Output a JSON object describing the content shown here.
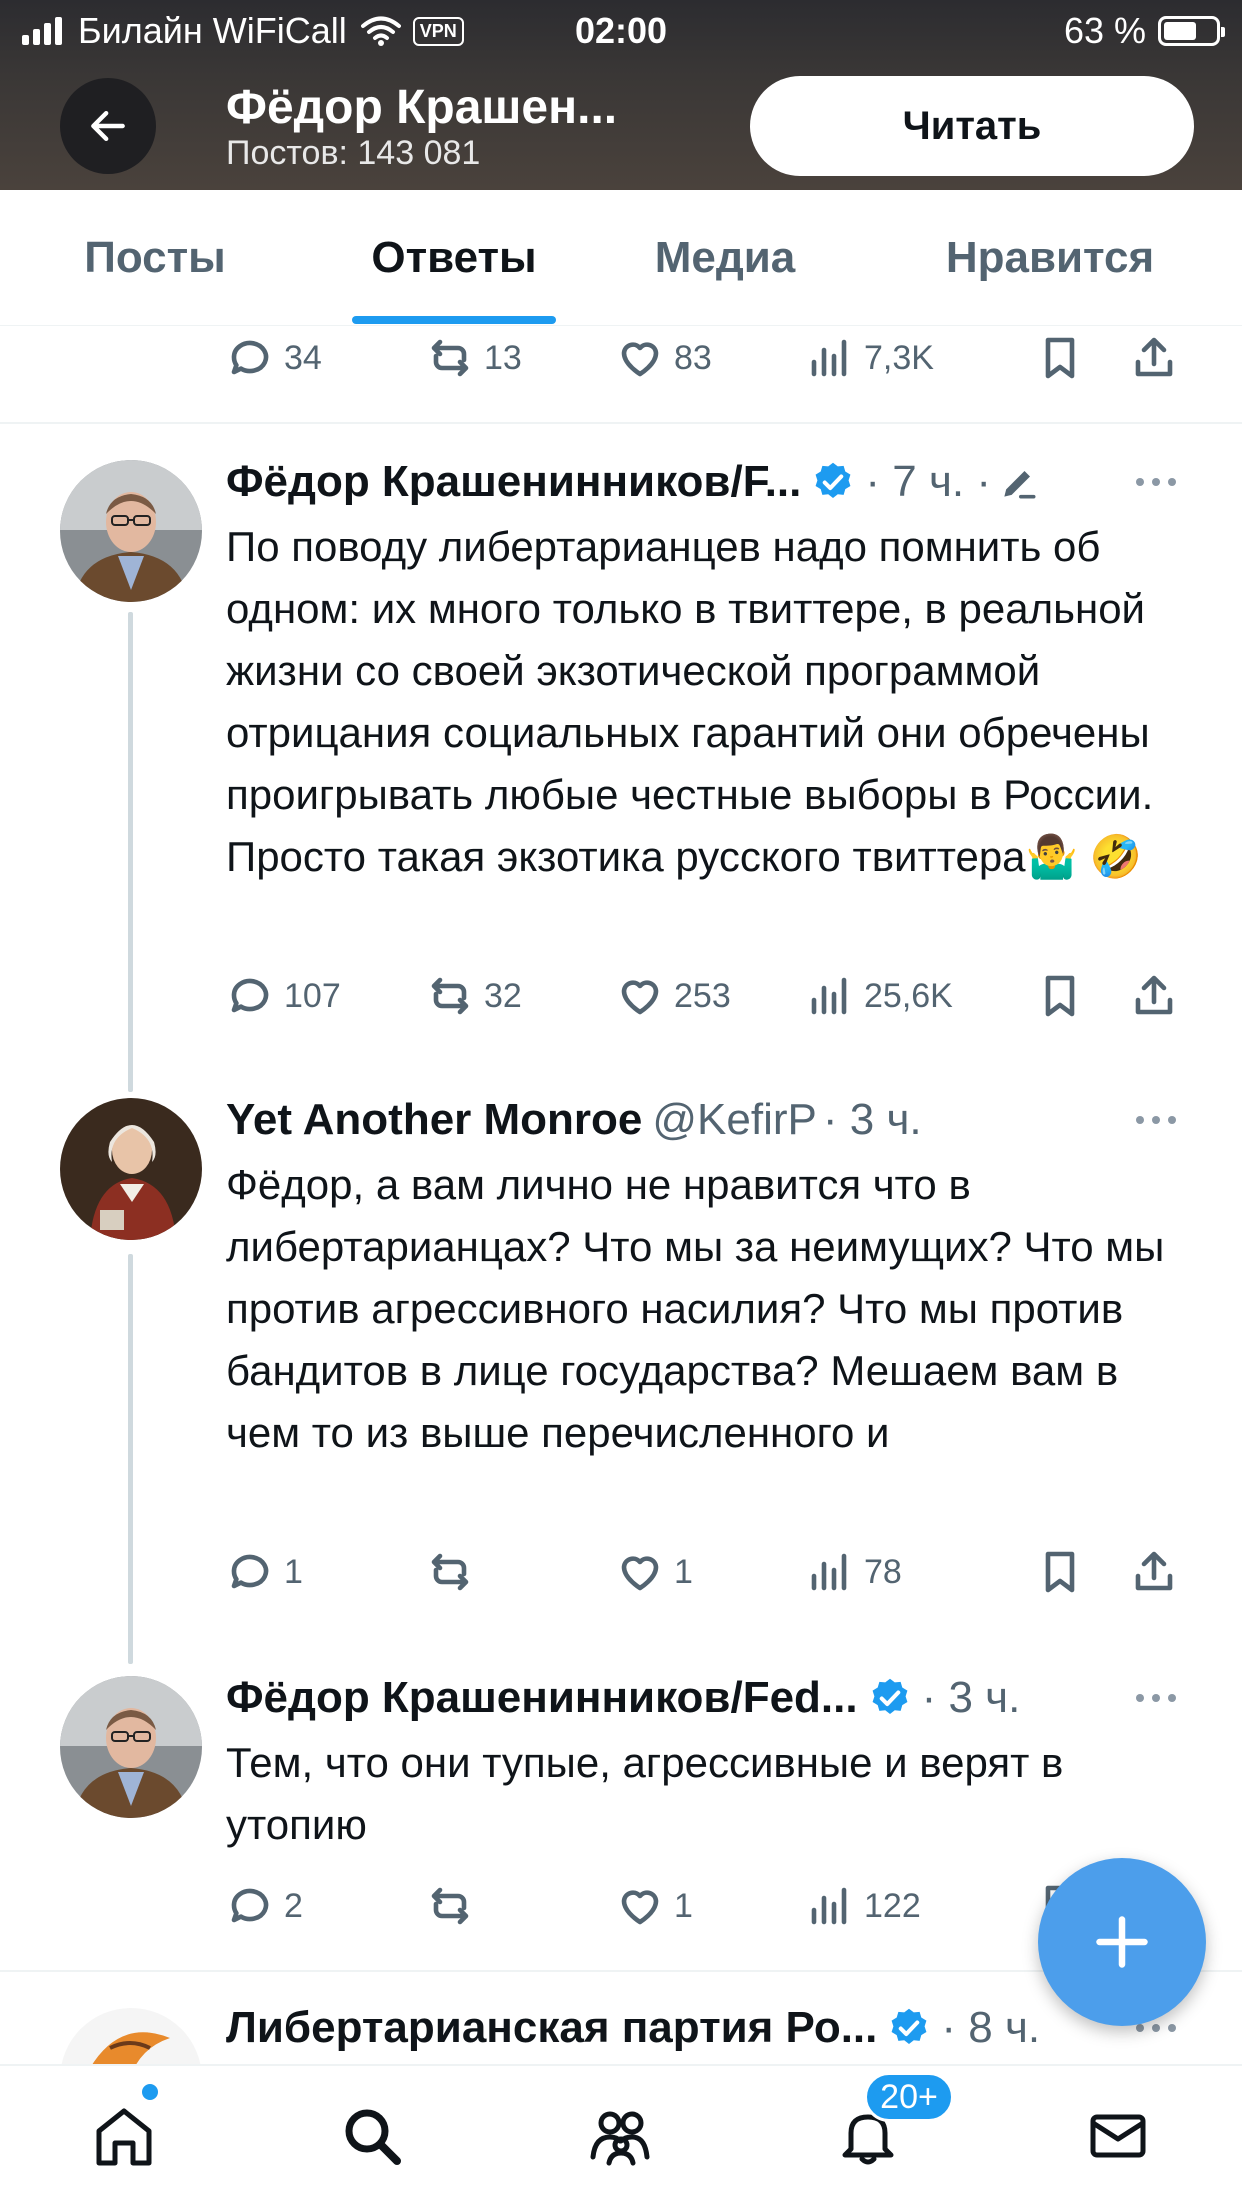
{
  "status_bar": {
    "carrier": "Билайн WiFiCall",
    "vpn": "VPN",
    "time": "02:00",
    "battery": "63 %",
    "battery_level": 0.63
  },
  "header": {
    "title": "Фёдор Крашен...",
    "posts_count": "Постов: 143 081",
    "follow_label": "Читать"
  },
  "tabs": [
    {
      "label": "Посты"
    },
    {
      "label": "Ответы",
      "active": true
    },
    {
      "label": "Медиа"
    },
    {
      "label": "Нравится"
    }
  ],
  "tweets": [
    {
      "replies": "34",
      "retweets": "13",
      "likes": "83",
      "views": "7,3K"
    },
    {
      "name": "Фёдор Крашенинников/F...",
      "verified": true,
      "meta": "· 7 ч. ·",
      "text": "По поводу либертарианцев надо помнить об одном: их много только в твиттере, в реальной жизни со своей экзотической программой отрицания социальных гарантий они обречены проигрывать любые честные выборы в России. Просто такая экзотика русского твиттера🤷‍♂️ 🤣",
      "replies": "107",
      "retweets": "32",
      "likes": "253",
      "views": "25,6K"
    },
    {
      "name": "Yet Another Monroe",
      "handle": "@KefirP",
      "meta": "· 3 ч.",
      "text": "Фёдор, а вам лично не нравится что в либертарианцах? Что мы за неимущих? Что мы против агрессивного насилия? Что мы против бандитов в лице государства? Мешаем вам в чем то из выше перечисленного и",
      "replies": "1",
      "retweets": "",
      "likes": "1",
      "views": "78"
    },
    {
      "name": "Фёдор Крашенинников/Fed...",
      "verified": true,
      "meta": "· 3 ч.",
      "text": "Тем, что они тупые, агрессивные и верят в утопию",
      "replies": "2",
      "retweets": "",
      "likes": "1",
      "views": "122"
    },
    {
      "name": "Либертарианская партия Ро...",
      "verified": true,
      "meta": "· 8 ч."
    }
  ],
  "bottom_nav": {
    "notifications_badge": "20+"
  },
  "colors": {
    "accent": "#1d9bf0",
    "secondary_text": "#536471",
    "primary_text": "#0f1419"
  }
}
